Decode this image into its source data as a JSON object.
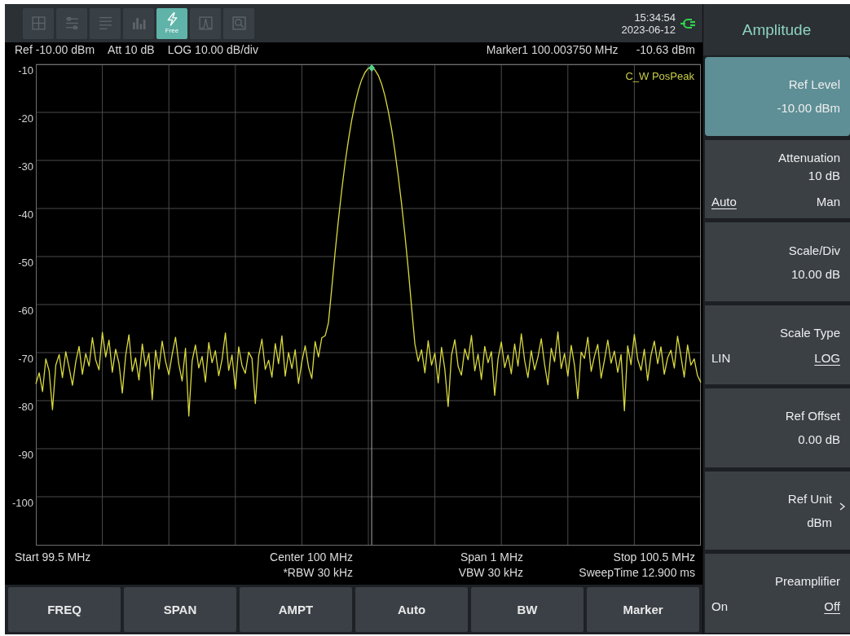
{
  "top_bar": {
    "toolbar": [
      {
        "selected": false
      },
      {
        "selected": false
      },
      {
        "selected": false
      },
      {
        "selected": false
      },
      {
        "label": "Free",
        "selected": true
      },
      {
        "selected": false
      },
      {
        "selected": false
      }
    ],
    "time": "15:34:54",
    "date": "2023-06-12"
  },
  "info_line": {
    "settings": [
      "Ref -10.00 dBm",
      "Att 10 dB",
      "LOG 10.00 dB/div"
    ],
    "marker_frequency": "Marker1 100.003750 MHz",
    "marker_level": "-10.63 dBm"
  },
  "plot": {
    "trace_label": "C_W PosPeak",
    "chart_data": [
      {
        "type": "line",
        "ylim": [
          -110,
          -10
        ],
        "yticks": [
          {
            "value": -10,
            "label": "-10"
          },
          {
            "value": -20,
            "label": "-20"
          },
          {
            "value": -30,
            "label": "-30"
          },
          {
            "value": -40,
            "label": "-40"
          },
          {
            "value": -50,
            "label": "-50"
          },
          {
            "value": -60,
            "label": "-60"
          },
          {
            "value": -70,
            "label": "-70"
          },
          {
            "value": -80,
            "label": "-80"
          },
          {
            "value": -90,
            "label": "-90"
          },
          {
            "value": -100,
            "label": "-100"
          }
        ],
        "tick_labels": "y",
        "grid": true,
        "color": "#dada3e",
        "categories": [
          null,
          null,
          null,
          null,
          null,
          null,
          null,
          null,
          null,
          null,
          null,
          null,
          null,
          null,
          null,
          null,
          null,
          null,
          null,
          null,
          null,
          null,
          null,
          null,
          null,
          null,
          null,
          null,
          null,
          null,
          null,
          null,
          null,
          null,
          null,
          null,
          null,
          null,
          null,
          null,
          null,
          null,
          null,
          null,
          null,
          null,
          null,
          null,
          null,
          null,
          null,
          null,
          null,
          null,
          null,
          null,
          null,
          null,
          null,
          null,
          null,
          null,
          null,
          null,
          null,
          null,
          null,
          null,
          null,
          null,
          null,
          null,
          null,
          null,
          null,
          null,
          null,
          null,
          null,
          null,
          null,
          null,
          null,
          null,
          null,
          null,
          null,
          null,
          null,
          null,
          null,
          null,
          null,
          null,
          null,
          null,
          null,
          null,
          null,
          null,
          null,
          null,
          null,
          null,
          null,
          null,
          null,
          null,
          null,
          null,
          null,
          null,
          null,
          null,
          null,
          null,
          null,
          null,
          null,
          null,
          null,
          null,
          null,
          null,
          null,
          null,
          null,
          null,
          null,
          null,
          null,
          null,
          null,
          null,
          null,
          null,
          null,
          null,
          null,
          null,
          null,
          null,
          null,
          null,
          null,
          null,
          null,
          null,
          null,
          null,
          null,
          null,
          null,
          null,
          null,
          null,
          null,
          null,
          null,
          null,
          null,
          null,
          null,
          null,
          null,
          null,
          null,
          null,
          null,
          null,
          null,
          null,
          null,
          null,
          null,
          null,
          null,
          null,
          null,
          null,
          null,
          null,
          null,
          null,
          null,
          null,
          null,
          null,
          null,
          null,
          null,
          null,
          null,
          null,
          null,
          null,
          null,
          null,
          null,
          null,
          null
        ],
        "values": [
          -76.5,
          -74.2,
          -78.1,
          -71.3,
          -73.8,
          -81.9,
          -72.6,
          -70.4,
          -75.2,
          -69.8,
          -73.1,
          -76.8,
          -71.9,
          -68.7,
          -74.5,
          -70.2,
          -72.8,
          -66.9,
          -71.5,
          -73.6,
          -65.8,
          -70.9,
          -67.4,
          -74.1,
          -69.3,
          -72.2,
          -78.4,
          -70.6,
          -66.3,
          -73.9,
          -71.1,
          -75.7,
          -68.2,
          -72.9,
          -70.1,
          -79.8,
          -69.5,
          -73.4,
          -67.6,
          -71.8,
          -74.6,
          -70.3,
          -66.8,
          -72.4,
          -75.9,
          -69.1,
          -83.2,
          -71.7,
          -68.4,
          -73.2,
          -70.8,
          -76.1,
          -67.9,
          -72.1,
          -69.6,
          -74.8,
          -71.4,
          -65.9,
          -73.7,
          -70.5,
          -77.6,
          -68.8,
          -72.7,
          -74.3,
          -69.9,
          -71.2,
          -80.6,
          -70.7,
          -67.2,
          -73.5,
          -71.6,
          -75.1,
          -68.1,
          -72.3,
          -66.5,
          -74.9,
          -70,
          -73.3,
          -69.4,
          -76.4,
          -71.9,
          -68.6,
          -73,
          -75.4,
          -67.7,
          -70.9,
          -66.9,
          -66.5,
          -63.8,
          -56.6,
          -49.1,
          -42.3,
          -36.1,
          -30.6,
          -25.8,
          -21.6,
          -18.1,
          -15.3,
          -13.2,
          -11.7,
          -10.8,
          -10.7,
          -11.2,
          -12.3,
          -14.1,
          -16.6,
          -19.8,
          -23.6,
          -28.1,
          -33.3,
          -39.1,
          -45.6,
          -52.7,
          -60.5,
          -68.2,
          -71.8,
          -69.4,
          -74.2,
          -67.5,
          -72.6,
          -70.1,
          -76.3,
          -68.9,
          -73.4,
          -81.2,
          -70.6,
          -67.3,
          -72.9,
          -74.7,
          -69.2,
          -71.5,
          -66.4,
          -73.8,
          -70.3,
          -75.6,
          -68.7,
          -72.1,
          -69.8,
          -78.9,
          -71.3,
          -67.8,
          -73.1,
          -70.5,
          -74.4,
          -68.2,
          -72.8,
          -66.1,
          -71.7,
          -75.2,
          -69.6,
          -73.6,
          -70.9,
          -67.1,
          -72.4,
          -76.7,
          -69.1,
          -71.9,
          -65.7,
          -73.3,
          -70.2,
          -74.9,
          -68.5,
          -72.7,
          -79.6,
          -69.9,
          -71.2,
          -66.8,
          -73.9,
          -70.8,
          -68.3,
          -75.3,
          -71.6,
          -67.4,
          -72.2,
          -69.7,
          -74.1,
          -70.4,
          -82.1,
          -68.6,
          -72.5,
          -66.2,
          -71.4,
          -73.7,
          -69.3,
          -75.8,
          -70.6,
          -67.6,
          -72.3,
          -68.8,
          -74.5,
          -71.1,
          -69.5,
          -73.2,
          -66.6,
          -70.7,
          -75.1,
          -68.4,
          -72.6,
          -71.3,
          -74.8,
          -76.2
        ]
      }
    ]
  },
  "frequency_info": [
    {
      "top": "Start 99.5 MHz"
    },
    {
      "top": "Center 100 MHz",
      "bottom": "*RBW 30 kHz"
    },
    {
      "top": "Span 1 MHz",
      "bottom": "VBW 30 kHz"
    },
    {
      "top": "Stop 100.5 MHz",
      "bottom": "SweepTime 12.900 ms"
    }
  ],
  "bottom_buttons": [
    "FREQ",
    "SPAN",
    "AMPT",
    "Auto",
    "BW",
    "Marker"
  ],
  "menu": {
    "title": "Amplitude",
    "keys": [
      {
        "kind": "value",
        "label": "Ref Level",
        "value": "-10.00 dBm",
        "selected": true
      },
      {
        "kind": "choice",
        "label": "Attenuation",
        "value": "10 dB",
        "options": [
          {
            "label": "Auto",
            "selected": true
          },
          {
            "label": "Man",
            "selected": false
          }
        ],
        "selected": false
      },
      {
        "kind": "value",
        "label": "Scale/Div",
        "value": "10.00 dB",
        "selected": false
      },
      {
        "kind": "choice",
        "label": "Scale Type",
        "options": [
          {
            "label": "LIN",
            "selected": false
          },
          {
            "label": "LOG",
            "selected": true
          }
        ],
        "selected": false
      },
      {
        "kind": "value",
        "label": "Ref Offset",
        "value": "0.00 dB",
        "selected": false
      },
      {
        "kind": "submenu",
        "label": "Ref Unit",
        "value": "dBm",
        "selected": false
      },
      {
        "kind": "choice",
        "label": "Preamplifier",
        "options": [
          {
            "label": "On",
            "selected": false
          },
          {
            "label": "Off",
            "selected": true
          }
        ],
        "selected": false
      }
    ]
  }
}
